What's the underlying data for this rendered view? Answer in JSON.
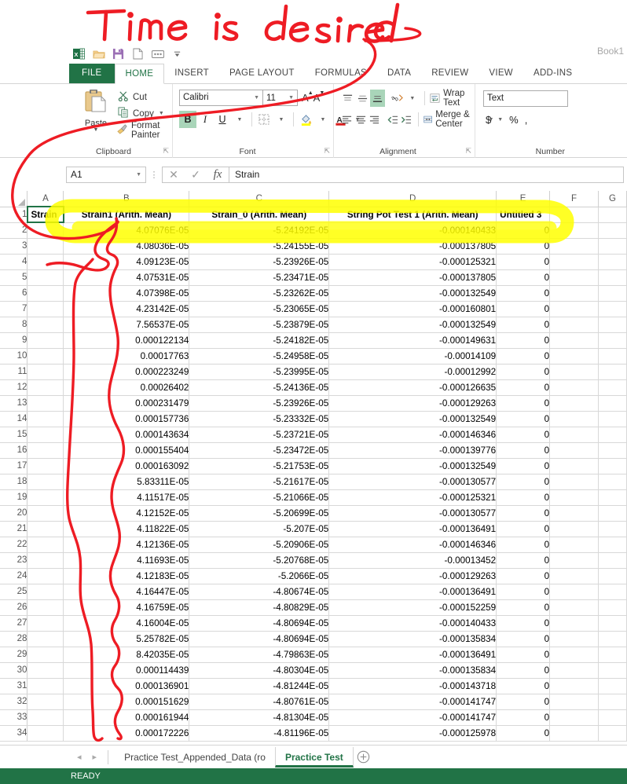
{
  "annotation": {
    "handwriting_text": "Time is desired",
    "ink_color": "#ee1c24",
    "highlight_color": "#ffff00"
  },
  "window": {
    "book_title": "Book1"
  },
  "quick_access": {
    "items": [
      {
        "name": "excel-logo-icon",
        "label": "X"
      },
      {
        "name": "open-folder-icon",
        "label": "Open"
      },
      {
        "name": "save-icon",
        "label": "Save"
      },
      {
        "name": "new-file-icon",
        "label": "New"
      },
      {
        "name": "touch-mode-icon",
        "label": "Touch/Mouse Mode"
      },
      {
        "name": "customize-qat-caret-icon",
        "label": "Customize Quick Access Toolbar"
      }
    ]
  },
  "ribbon": {
    "file_tab": "FILE",
    "tabs": [
      {
        "label": "HOME",
        "active": true
      },
      {
        "label": "INSERT",
        "active": false
      },
      {
        "label": "PAGE LAYOUT",
        "active": false
      },
      {
        "label": "FORMULAS",
        "active": false
      },
      {
        "label": "DATA",
        "active": false
      },
      {
        "label": "REVIEW",
        "active": false
      },
      {
        "label": "VIEW",
        "active": false
      },
      {
        "label": "ADD-INS",
        "active": false
      }
    ],
    "clipboard": {
      "group_label": "Clipboard",
      "paste_label": "Paste",
      "cut_label": "Cut",
      "copy_label": "Copy",
      "format_painter_label": "Format Painter"
    },
    "font": {
      "group_label": "Font",
      "font_name": "Calibri",
      "font_size": "11",
      "grow_label": "A",
      "shrink_label": "A",
      "bold_label": "B",
      "italic_label": "I",
      "underline_label": "U",
      "borders_label": "Borders",
      "fill_color_label": "A",
      "font_color_label": "A"
    },
    "alignment": {
      "group_label": "Alignment",
      "wrap_text_label": "Wrap Text",
      "merge_center_label": "Merge & Center"
    },
    "number": {
      "group_label": "Number",
      "format_value": "Text",
      "currency_label": "$",
      "percent_label": "%",
      "comma_label": ","
    }
  },
  "formula_bar": {
    "name_box": "A1",
    "cancel_label": "✕",
    "enter_label": "✓",
    "function_label": "fx",
    "content": "Strain"
  },
  "grid": {
    "columns": [
      "A",
      "B",
      "C",
      "D",
      "E",
      "F",
      "G"
    ],
    "header_row_number": "1",
    "header_cells": [
      "Strain",
      "Strain1 (Arith. Mean)",
      "Strain_0 (Arith. Mean)",
      "String Pot Test 1 (Arith. Mean)",
      "Untitled 3",
      "",
      ""
    ],
    "rows": [
      {
        "n": "2",
        "cells": [
          "",
          "4.07076E-05",
          "-5.24192E-05",
          "-0.000140433",
          "0",
          "",
          ""
        ]
      },
      {
        "n": "3",
        "cells": [
          "",
          "4.08036E-05",
          "-5.24155E-05",
          "-0.000137805",
          "0",
          "",
          ""
        ]
      },
      {
        "n": "4",
        "cells": [
          "",
          "4.09123E-05",
          "-5.23926E-05",
          "-0.000125321",
          "0",
          "",
          ""
        ]
      },
      {
        "n": "5",
        "cells": [
          "",
          "4.07531E-05",
          "-5.23471E-05",
          "-0.000137805",
          "0",
          "",
          ""
        ]
      },
      {
        "n": "6",
        "cells": [
          "",
          "4.07398E-05",
          "-5.23262E-05",
          "-0.000132549",
          "0",
          "",
          ""
        ]
      },
      {
        "n": "7",
        "cells": [
          "",
          "4.23142E-05",
          "-5.23065E-05",
          "-0.000160801",
          "0",
          "",
          ""
        ]
      },
      {
        "n": "8",
        "cells": [
          "",
          "7.56537E-05",
          "-5.23879E-05",
          "-0.000132549",
          "0",
          "",
          ""
        ]
      },
      {
        "n": "9",
        "cells": [
          "",
          "0.000122134",
          "-5.24182E-05",
          "-0.000149631",
          "0",
          "",
          ""
        ]
      },
      {
        "n": "10",
        "cells": [
          "",
          "0.00017763",
          "-5.24958E-05",
          "-0.00014109",
          "0",
          "",
          ""
        ]
      },
      {
        "n": "11",
        "cells": [
          "",
          "0.000223249",
          "-5.23995E-05",
          "-0.00012992",
          "0",
          "",
          ""
        ]
      },
      {
        "n": "12",
        "cells": [
          "",
          "0.00026402",
          "-5.24136E-05",
          "-0.000126635",
          "0",
          "",
          ""
        ]
      },
      {
        "n": "13",
        "cells": [
          "",
          "0.000231479",
          "-5.23926E-05",
          "-0.000129263",
          "0",
          "",
          ""
        ]
      },
      {
        "n": "14",
        "cells": [
          "",
          "0.000157736",
          "-5.23332E-05",
          "-0.000132549",
          "0",
          "",
          ""
        ]
      },
      {
        "n": "15",
        "cells": [
          "",
          "0.000143634",
          "-5.23721E-05",
          "-0.000146346",
          "0",
          "",
          ""
        ]
      },
      {
        "n": "16",
        "cells": [
          "",
          "0.000155404",
          "-5.23472E-05",
          "-0.000139776",
          "0",
          "",
          ""
        ]
      },
      {
        "n": "17",
        "cells": [
          "",
          "0.000163092",
          "-5.21753E-05",
          "-0.000132549",
          "0",
          "",
          ""
        ]
      },
      {
        "n": "18",
        "cells": [
          "",
          "5.83311E-05",
          "-5.21617E-05",
          "-0.000130577",
          "0",
          "",
          ""
        ]
      },
      {
        "n": "19",
        "cells": [
          "",
          "4.11517E-05",
          "-5.21066E-05",
          "-0.000125321",
          "0",
          "",
          ""
        ]
      },
      {
        "n": "20",
        "cells": [
          "",
          "4.12152E-05",
          "-5.20699E-05",
          "-0.000130577",
          "0",
          "",
          ""
        ]
      },
      {
        "n": "21",
        "cells": [
          "",
          "4.11822E-05",
          "-5.207E-05",
          "-0.000136491",
          "0",
          "",
          ""
        ]
      },
      {
        "n": "22",
        "cells": [
          "",
          "4.12136E-05",
          "-5.20906E-05",
          "-0.000146346",
          "0",
          "",
          ""
        ]
      },
      {
        "n": "23",
        "cells": [
          "",
          "4.11693E-05",
          "-5.20768E-05",
          "-0.00013452",
          "0",
          "",
          ""
        ]
      },
      {
        "n": "24",
        "cells": [
          "",
          "4.12183E-05",
          "-5.2066E-05",
          "-0.000129263",
          "0",
          "",
          ""
        ]
      },
      {
        "n": "25",
        "cells": [
          "",
          "4.16447E-05",
          "-4.80674E-05",
          "-0.000136491",
          "0",
          "",
          ""
        ]
      },
      {
        "n": "26",
        "cells": [
          "",
          "4.16759E-05",
          "-4.80829E-05",
          "-0.000152259",
          "0",
          "",
          ""
        ]
      },
      {
        "n": "27",
        "cells": [
          "",
          "4.16004E-05",
          "-4.80694E-05",
          "-0.000140433",
          "0",
          "",
          ""
        ]
      },
      {
        "n": "28",
        "cells": [
          "",
          "5.25782E-05",
          "-4.80694E-05",
          "-0.000135834",
          "0",
          "",
          ""
        ]
      },
      {
        "n": "29",
        "cells": [
          "",
          "8.42035E-05",
          "-4.79863E-05",
          "-0.000136491",
          "0",
          "",
          ""
        ]
      },
      {
        "n": "30",
        "cells": [
          "",
          "0.000114439",
          "-4.80304E-05",
          "-0.000135834",
          "0",
          "",
          ""
        ]
      },
      {
        "n": "31",
        "cells": [
          "",
          "0.000136901",
          "-4.81244E-05",
          "-0.000143718",
          "0",
          "",
          ""
        ]
      },
      {
        "n": "32",
        "cells": [
          "",
          "0.000151629",
          "-4.80761E-05",
          "-0.000141747",
          "0",
          "",
          ""
        ]
      },
      {
        "n": "33",
        "cells": [
          "",
          "0.000161944",
          "-4.81304E-05",
          "-0.000141747",
          "0",
          "",
          ""
        ]
      },
      {
        "n": "34",
        "cells": [
          "",
          "0.000172226",
          "-4.81196E-05",
          "-0.000125978",
          "0",
          "",
          ""
        ]
      }
    ]
  },
  "sheet_tabs": {
    "prev_label": "◂",
    "next_label": "▸",
    "tabs": [
      {
        "label": "Practice Test_Appended_Data (ro",
        "active": false
      },
      {
        "label": "Practice Test",
        "active": true
      }
    ],
    "add_label": "+"
  },
  "status_bar": {
    "text": "READY"
  }
}
